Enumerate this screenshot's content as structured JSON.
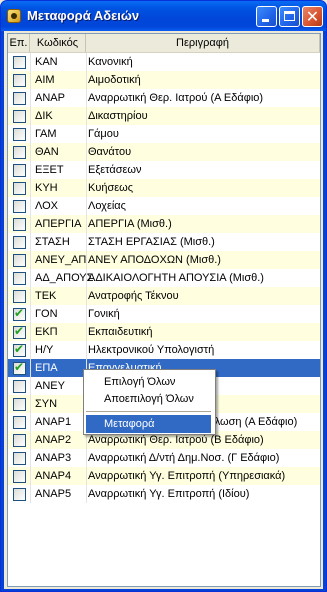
{
  "window": {
    "title": "Μεταφορά Αδειών"
  },
  "columns": {
    "ep": "Επ.",
    "code": "Κωδικός",
    "desc": "Περιγραφή"
  },
  "rows": [
    {
      "checked": false,
      "code": "ΚΑΝ",
      "desc": "Κανονική"
    },
    {
      "checked": false,
      "code": "ΑΙΜ",
      "desc": "Αιμοδοτική"
    },
    {
      "checked": false,
      "code": "ΑΝΑΡ",
      "desc": "Αναρρωτική Θερ. Ιατρού (Α Εδάφιο)"
    },
    {
      "checked": false,
      "code": "ΔΙΚ",
      "desc": "Δικαστηρίου"
    },
    {
      "checked": false,
      "code": "ΓΑΜ",
      "desc": "Γάμου"
    },
    {
      "checked": false,
      "code": "ΘΑΝ",
      "desc": "Θανάτου"
    },
    {
      "checked": false,
      "code": "ΕΞΕΤ",
      "desc": "Εξετάσεων"
    },
    {
      "checked": false,
      "code": "ΚΥΗ",
      "desc": "Κυήσεως"
    },
    {
      "checked": false,
      "code": "ΛΟΧ",
      "desc": "Λοχείας"
    },
    {
      "checked": false,
      "code": "ΑΠΕΡΓΙΑ",
      "desc": "ΑΠΕΡΓΙΑ (Μισθ.)"
    },
    {
      "checked": false,
      "code": "ΣΤΑΣΗ",
      "desc": "ΣΤΑΣΗ ΕΡΓΑΣΙΑΣ (Μισθ.)"
    },
    {
      "checked": false,
      "code": "ΑΝΕΥ_ΑΠ",
      "desc": "ΑΝΕΥ ΑΠΟΔΟΧΩΝ (Μισθ.)"
    },
    {
      "checked": false,
      "code": "ΑΔ_ΑΠΟΥΣ",
      "desc": "ΑΔΙΚΑΙΟΛΟΓΗΤΗ ΑΠΟΥΣΙΑ (Μισθ.)"
    },
    {
      "checked": false,
      "code": "ΤΕΚ",
      "desc": "Ανατροφής Τέκνου"
    },
    {
      "checked": true,
      "code": "ΓΟΝ",
      "desc": "Γονική"
    },
    {
      "checked": true,
      "code": "ΕΚΠ",
      "desc": "Εκπαιδευτική"
    },
    {
      "checked": true,
      "code": "Η/Υ",
      "desc": "Ηλεκτρονικού Υπολογιστή"
    },
    {
      "checked": true,
      "code": "ΕΠΑ",
      "desc": "Επαγγελματική",
      "selected": true
    },
    {
      "checked": false,
      "code": "ΑΝΕΥ",
      "desc": ""
    },
    {
      "checked": false,
      "code": "ΣΥΝ",
      "desc": ""
    },
    {
      "checked": false,
      "code": "ΑΝΑΡ1",
      "desc": "Αναρρωτική Υπεύθυνη Δήλωση (Α Εδάφιο)"
    },
    {
      "checked": false,
      "code": "ΑΝΑΡ2",
      "desc": "Αναρρωτική Θερ. Ιατρού (Β Εδάφιο)"
    },
    {
      "checked": false,
      "code": "ΑΝΑΡ3",
      "desc": "Αναρρωτική Δ/ντή Δημ.Νοσ. (Γ Εδάφιο)"
    },
    {
      "checked": false,
      "code": "ΑΝΑΡ4",
      "desc": "Αναρρωτική Υγ. Επιτροπή (Υπηρεσιακά)"
    },
    {
      "checked": false,
      "code": "ΑΝΑΡ5",
      "desc": "Αναρρωτική Υγ. Επιτροπή (Ιδίου)"
    }
  ],
  "context_menu": {
    "select_all": "Επιλογή Όλων",
    "deselect_all": "Αποεπιλογή Όλων",
    "transfer": "Μεταφορά"
  },
  "colors": {
    "selection": "#316ac5",
    "row_alt": "#ffffe0",
    "title_bar": "#0053e1"
  }
}
